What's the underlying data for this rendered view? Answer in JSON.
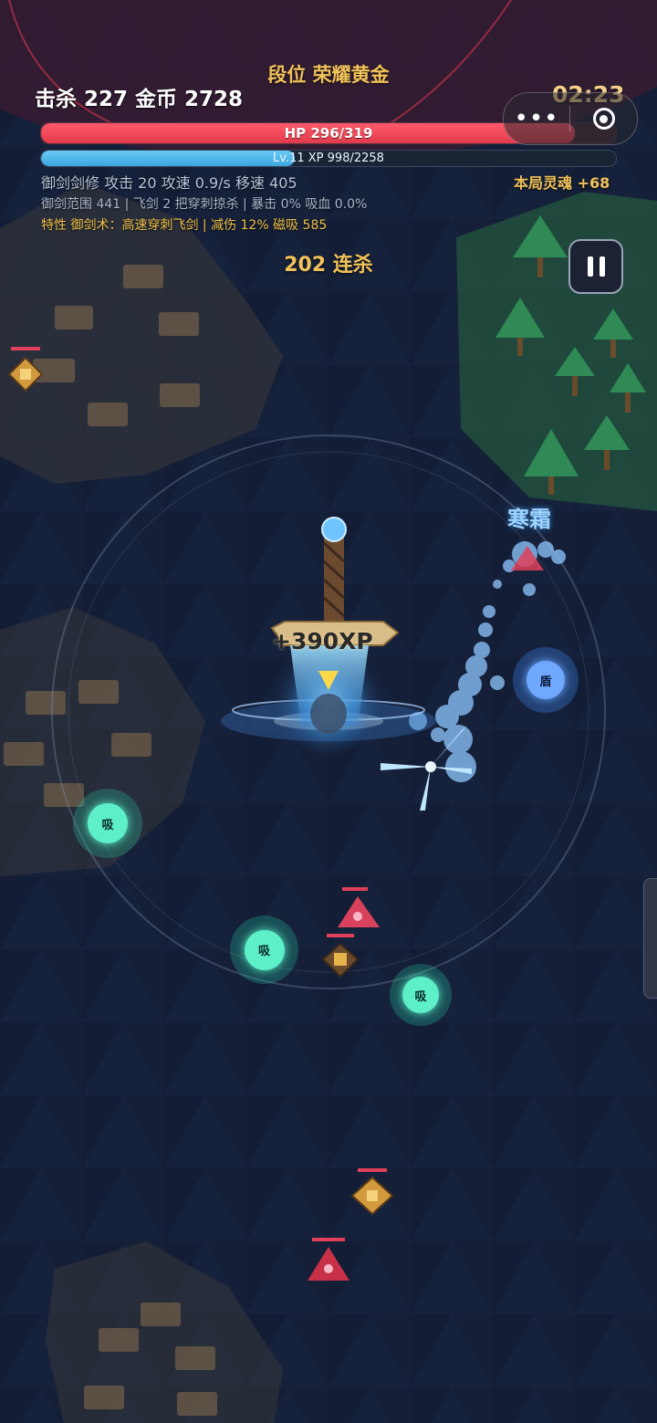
{
  "hud": {
    "rank": "段位 荣耀黄金",
    "kills_gold": "击杀 227  金币 2728",
    "timer": "02:23",
    "hp_label": "HP 296/319",
    "hp_fraction": 0.928,
    "xp_label": "Lv.11  XP 998/2258",
    "xp_fraction": 0.442,
    "stats_line1": "御剑剑修  攻击 20   攻速 0.9/s   移速 405",
    "soul": "本局灵魂 +68",
    "stats_line2": "御剑范围 441 | 飞剑 2 把穿刺掠杀 | 暴击 0% 吸血 0.0%",
    "stats_line3": "特性 御剑术：高速穿刺飞剑 | 减伤 12% 磁吸 585",
    "combo": "202 连杀"
  },
  "capsule": {
    "more_icon": "•••",
    "close_icon": "target-circle"
  },
  "field": {
    "frost_label": "寒霜",
    "xp_popup": "+390XP",
    "pickups": [
      {
        "label": "吸",
        "kind": "magnet"
      },
      {
        "label": "吸",
        "kind": "magnet"
      },
      {
        "label": "吸",
        "kind": "magnet"
      },
      {
        "label": "盾",
        "kind": "shield"
      }
    ]
  },
  "colors": {
    "gold": "#f2c35a",
    "hp": "#e23b4c",
    "xp": "#3aa6df",
    "magnet": "#5df0c8",
    "shield": "#6fa8ff"
  }
}
